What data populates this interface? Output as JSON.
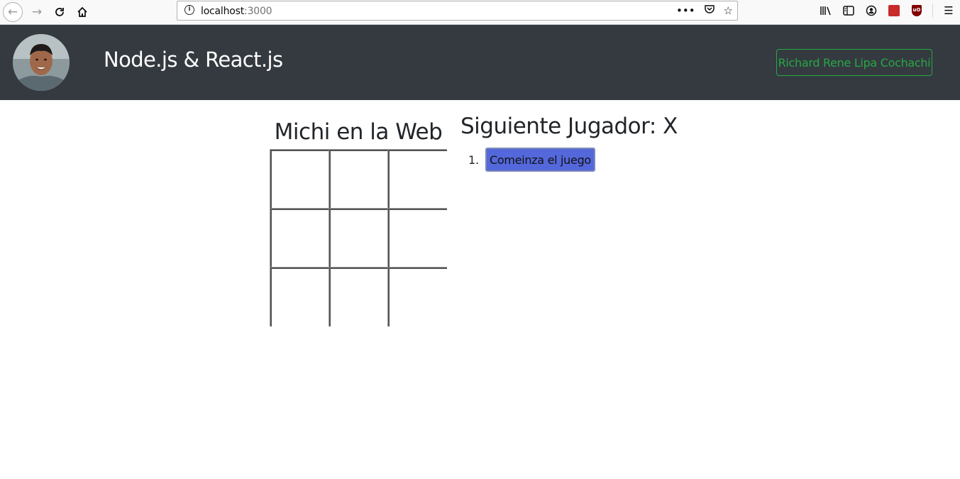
{
  "browser": {
    "url_host": "localhost",
    "url_port": ":3000",
    "page_actions_icon": "•••",
    "pocket_icon": "pocket-icon",
    "bookmark_icon": "star-icon"
  },
  "navbar": {
    "brand": "Node.js & React.js",
    "author": "Richard Rene Lipa Cochachi",
    "colors": {
      "background": "#343a40",
      "author_accent": "#28a745"
    }
  },
  "game": {
    "title": "Michi en la Web",
    "status": "Siguiente Jugador: X",
    "squares": [
      "",
      "",
      "",
      "",
      "",
      "",
      "",
      "",
      ""
    ],
    "moves": [
      {
        "number": "1.",
        "label": "Comeinza el juego"
      }
    ],
    "colors": {
      "move_button": "#5468dc"
    }
  }
}
